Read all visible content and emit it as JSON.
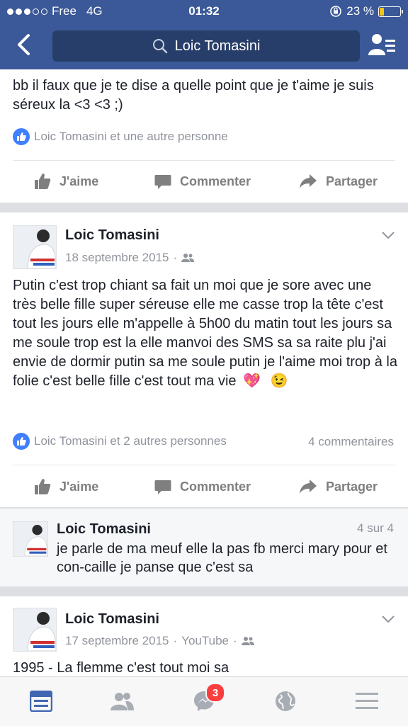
{
  "status": {
    "carrier": "Free",
    "network": "4G",
    "time": "01:32",
    "battery": "23 %",
    "battery_fraction": 0.23
  },
  "nav": {
    "search_text": "Loic Tomasini"
  },
  "post1": {
    "text": "bb il faux que je te dise a quelle point que je t'aime je suis séreux la  <3 <3 ;)",
    "likes": "Loic Tomasini et une autre personne",
    "actions": {
      "like": "J'aime",
      "comment": "Commenter",
      "share": "Partager"
    }
  },
  "post2": {
    "author": "Loic Tomasini",
    "date": "18 septembre 2015",
    "separator": "·",
    "text": "Putin c'est trop chiant sa fait un moi que je sore avec une très belle fille super séreuse elle me casse trop la tête c'est tout les jours elle m'appelle à 5h00 du matin tout les jours sa me soule trop est la elle manvoi des SMS sa sa raite plu j'ai envie de dormir putin sa me soule putin je l'aime moi trop à la folie c'est belle fille c'est tout ma vie",
    "emoji1": "💖",
    "emoji2": "😉",
    "likes": "Loic Tomasini et 2 autres personnes",
    "comments": "4 commentaires",
    "actions": {
      "like": "J'aime",
      "comment": "Commenter",
      "share": "Partager"
    }
  },
  "comment": {
    "author": "Loic Tomasini",
    "counter": "4 sur 4",
    "text": "je parle de ma meuf elle la pas fb merci mary pour et con-caille je panse que c'est sa"
  },
  "post3": {
    "author": "Loic Tomasini",
    "date": "17 septembre 2015",
    "separator": "·",
    "source": "YouTube",
    "text": "1995 - La flemme c'est tout moi sa"
  },
  "tabbar": {
    "messages_badge": "3"
  },
  "colors": {
    "brand": "#3b5998",
    "like_blue": "#4080ff",
    "badge_red": "#fa3e3e"
  }
}
